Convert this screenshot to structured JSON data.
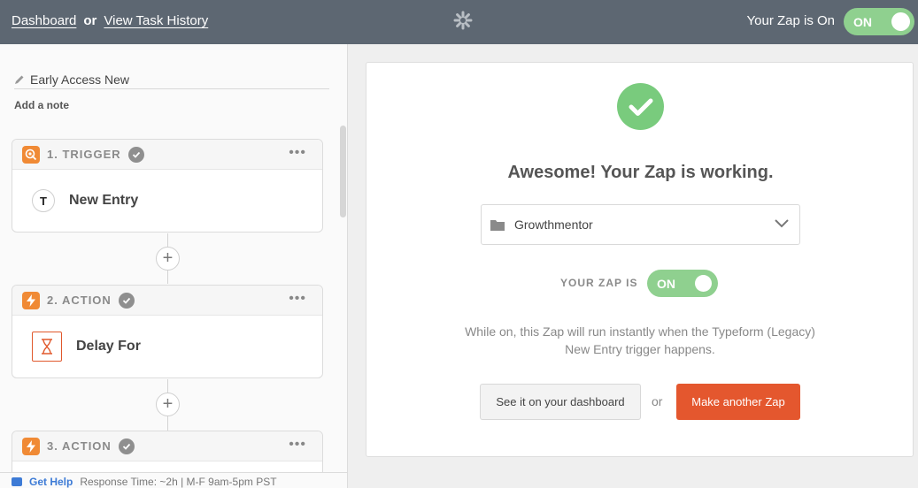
{
  "header": {
    "dashboard_link": "Dashboard",
    "or": "or",
    "history_link": "View Task History",
    "zap_status": "Your Zap is On",
    "toggle_label": "ON"
  },
  "sidebar": {
    "zap_name": "Early Access New",
    "add_note": "Add a note",
    "steps": [
      {
        "title": "1. TRIGGER",
        "label": "New Entry",
        "app_icon_letter": "T",
        "badge_icon": "trigger-target-icon"
      },
      {
        "title": "2. ACTION",
        "label": "Delay For",
        "app_icon": "hourglass-icon",
        "badge_icon": "lightning-icon"
      },
      {
        "title": "3. ACTION",
        "badge_icon": "lightning-icon"
      }
    ],
    "step_menu": "•••",
    "add_step": "+",
    "help": {
      "link": "Get Help",
      "text": "Response Time: ~2h | M-F 9am-5pm PST"
    }
  },
  "main": {
    "title": "Awesome! Your Zap is working.",
    "folder": "Growthmentor",
    "zap_is_label": "YOUR ZAP IS",
    "toggle_label": "ON",
    "description": "While on, this Zap will run instantly when the Typeform (Legacy) New Entry trigger happens.",
    "dashboard_button": "See it on your dashboard",
    "or": "or",
    "another_button": "Make another Zap"
  },
  "colors": {
    "header_bg": "#5d6772",
    "toggle_on": "#8fd08f",
    "success": "#79cb7d",
    "primary_button": "#e4572e",
    "step_badge": "#f08a35",
    "link_blue": "#3d7bd6"
  }
}
